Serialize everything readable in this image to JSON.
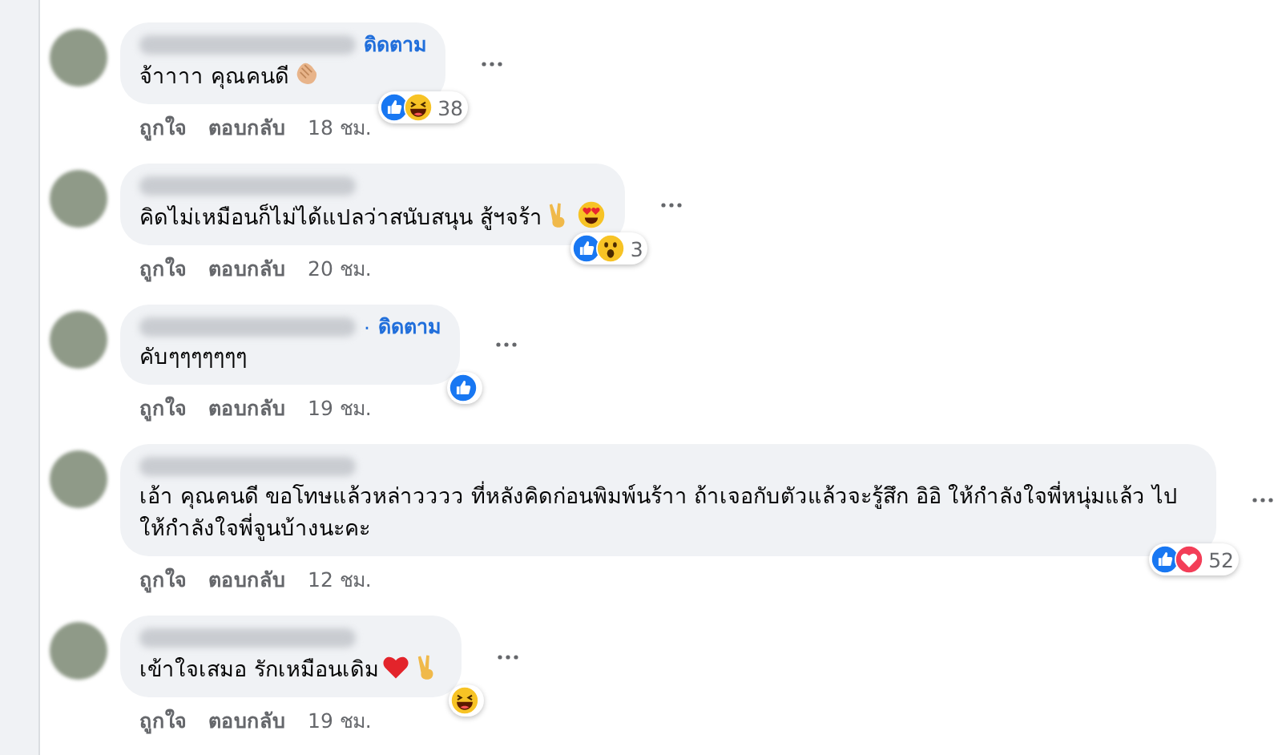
{
  "comments": [
    {
      "follow": "ดิดตาม",
      "text": "จ้าาาา คุณคนดี",
      "emojis": [
        {
          "kind": "clap"
        }
      ],
      "reactions": {
        "icons": [
          {
            "kind": "like"
          },
          {
            "kind": "haha"
          }
        ],
        "count": "38"
      },
      "actions": [
        "ถูกใจ",
        "ตอบกลับ"
      ],
      "time": "18 ชม."
    },
    {
      "text": "คิดไม่เหมือนก็ไม่ได้แปลว่าสนับสนุน สู้ฯจร้า",
      "emojis": [
        {
          "kind": "victory"
        },
        {
          "kind": "heart-eyes"
        }
      ],
      "reactions": {
        "icons": [
          {
            "kind": "like"
          },
          {
            "kind": "wow"
          }
        ],
        "count": "3"
      },
      "actions": [
        "ถูกใจ",
        "ตอบกลับ"
      ],
      "time": "20 ชม."
    },
    {
      "follow_separator": "·",
      "follow": "ดิดตาม",
      "text": "คับๆๆๆๆๆๆๆ",
      "reactions": {
        "icons": [
          {
            "kind": "like"
          }
        ]
      },
      "actions": [
        "ถูกใจ",
        "ตอบกลับ"
      ],
      "time": "19 ชม."
    },
    {
      "text": "เอ้า คุณคนดี ขอโทษแล้วหล่าวววว ที่หลังคิดก่อนพิมพ์นร้าา ถ้าเจอกับตัวแล้วจะรู้สึก อิอิ ให้กำลังใจพี่หนุ่มแล้ว ไปให้กำลังใจพี่จูนบ้างนะคะ",
      "reactions": {
        "icons": [
          {
            "kind": "like"
          },
          {
            "kind": "love"
          }
        ],
        "count": "52"
      },
      "actions": [
        "ถูกใจ",
        "ตอบกลับ"
      ],
      "time": "12 ชม."
    },
    {
      "text": "เข้าใจเสมอ รักเหมือนเดิม",
      "emojis": [
        {
          "kind": "heart"
        },
        {
          "kind": "victory"
        }
      ],
      "reactions": {
        "icons": [
          {
            "kind": "haha"
          }
        ]
      },
      "actions": [
        "ถูกใจ",
        "ตอบกลับ"
      ],
      "time": "19 ชม."
    }
  ]
}
